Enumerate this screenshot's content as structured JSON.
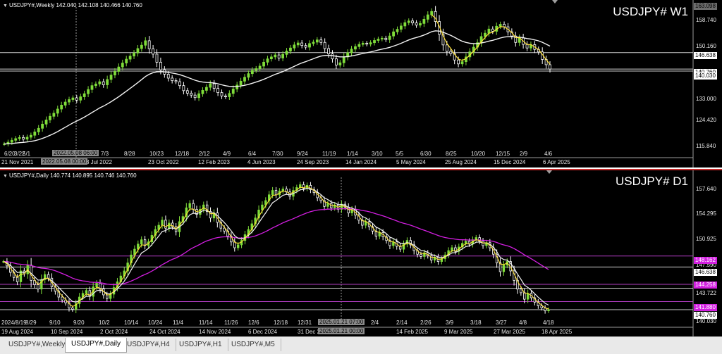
{
  "colors": {
    "background": "#000000",
    "bull_candle": "#7fdc3a",
    "bear_candle": "#ffffff",
    "ma_white": "#f2f2f2",
    "ma_yellow": "#ffe135",
    "ma_magenta": "#d21ee0",
    "level_line": "#cfcfcf",
    "tag_magenta": "#d21ee0",
    "divider": "#c62828"
  },
  "weekly": {
    "info": "USDJPY#,Weekly  142.040  142.108 140.466 140.760",
    "title": "USDJPY# W1",
    "price_ticks": [
      "158.740",
      "150.160",
      "141.580",
      "133.000",
      "124.420",
      "115.840"
    ],
    "price_tags": [
      {
        "text": "163.098",
        "style": "plain"
      },
      {
        "text": "146.638",
        "style": "white"
      },
      {
        "text": "140.760",
        "style": "white"
      },
      {
        "text": "140.030",
        "style": "white"
      }
    ],
    "ylim": [
      112,
      164
    ],
    "levels": [
      146.638,
      140.76,
      140.03
    ],
    "crosshair_tag": "2022.05.08 06:00",
    "crosshair_tag2": "2022.05.08 00:00",
    "top_dates": [
      "6/20",
      "3/22",
      "5/1",
      "7/3",
      "8/28",
      "10/23",
      "12/18",
      "2/12",
      "4/9",
      "6/4",
      "7/30",
      "9/24",
      "11/19",
      "1/14",
      "3/10",
      "5/5",
      "6/30",
      "8/25",
      "10/20",
      "12/15",
      "2/9",
      "4/6"
    ],
    "bottom_dates": [
      "21 Nov 2021",
      "3 Jul 2022",
      "23 Oct 2022",
      "12 Feb 2023",
      "4 Jun 2023",
      "24 Sep 2023",
      "14 Jan 2024",
      "5 May 2024",
      "25 Aug 2024",
      "15 Dec 2024",
      "6 Apr 2025"
    ]
  },
  "daily": {
    "info": "USDJPY#,Daily  140.774 140.895 140.746 140.760",
    "title": "USDJPY# D1",
    "price_ticks": [
      "157.640",
      "154.295",
      "150.925",
      "147.590",
      "143.722",
      "140.030"
    ],
    "price_tags": [
      {
        "text": "148.162",
        "style": "magenta"
      },
      {
        "text": "146.638",
        "style": "white"
      },
      {
        "text": "144.258",
        "style": "magenta"
      },
      {
        "text": "141.880",
        "style": "magenta"
      },
      {
        "text": "140.760",
        "style": "white"
      }
    ],
    "ylim": [
      139.4,
      159.2
    ],
    "levels_white": [
      146.638,
      143.722,
      140.76
    ],
    "levels_magenta": [
      148.162,
      144.258,
      141.88
    ],
    "crosshair_tag": "2025.01.21 07:00",
    "crosshair_tag2": "2025.01.21 00:00",
    "top_dates": [
      "2024/8/19",
      "8/29",
      "9/10",
      "9/20",
      "10/2",
      "10/14",
      "10/24",
      "11/4",
      "11/14",
      "11/26",
      "12/6",
      "12/18",
      "12/31",
      "1/9",
      "1/21",
      "2/4",
      "2/14",
      "2/26",
      "3/9",
      "3/18",
      "3/27",
      "4/8",
      "4/18"
    ],
    "bottom_dates": [
      "19 Aug 2024",
      "10 Sep 2024",
      "2 Oct 2024",
      "24 Oct 2024",
      "14 Nov 2024",
      "6 Dec 2024",
      "31 Dec 2024",
      "21 Jan 2025",
      "14 Feb 2025",
      "9 Mar 2025",
      "27 Mar 2025",
      "18 Apr 2025"
    ]
  },
  "tabs": [
    {
      "label": "USDJPY#,Weekly",
      "active": false
    },
    {
      "label": "USDJPY#,Daily",
      "active": true
    },
    {
      "label": "USDJPY#,H4",
      "active": false
    },
    {
      "label": "USDJPY#,H1",
      "active": false
    },
    {
      "label": "USDJPY#,M5",
      "active": false
    }
  ],
  "chart_data": [
    {
      "type": "candlestick",
      "title": "USDJPY# W1",
      "symbol": "USDJPY#",
      "timeframe": "Weekly",
      "ylim": [
        112,
        164
      ],
      "closes": [
        113.9,
        114.5,
        115.2,
        115.8,
        116.2,
        115.6,
        116.3,
        117.0,
        118.2,
        119.5,
        121.0,
        122.5,
        123.8,
        124.9,
        126.4,
        127.8,
        128.9,
        129.8,
        130.4,
        129.6,
        130.8,
        131.9,
        133.4,
        134.8,
        135.4,
        136.2,
        135.1,
        137.0,
        138.6,
        139.9,
        141.5,
        142.9,
        144.3,
        145.4,
        146.5,
        148.1,
        149.3,
        150.9,
        148.0,
        146.1,
        143.2,
        140.5,
        138.9,
        137.5,
        136.6,
        136.2,
        134.8,
        133.0,
        132.1,
        131.4,
        130.5,
        131.9,
        133.1,
        134.2,
        135.5,
        133.8,
        132.3,
        131.1,
        130.8,
        132.0,
        133.6,
        135.0,
        136.4,
        137.8,
        139.1,
        140.3,
        140.9,
        141.8,
        143.2,
        144.4,
        145.1,
        145.8,
        144.7,
        146.0,
        147.2,
        148.3,
        149.4,
        150.1,
        149.2,
        148.6,
        149.9,
        150.4,
        151.2,
        150.3,
        148.1,
        146.2,
        144.4,
        142.2,
        143.0,
        145.1,
        146.6,
        147.9,
        148.8,
        149.6,
        150.0,
        149.7,
        150.2,
        151.0,
        151.5,
        151.8,
        151.3,
        152.6,
        154.1,
        155.0,
        156.2,
        157.4,
        158.0,
        157.3,
        156.5,
        157.1,
        158.6,
        160.2,
        161.4,
        157.8,
        153.2,
        149.4,
        147.1,
        146.3,
        144.0,
        142.6,
        143.4,
        145.1,
        146.9,
        148.6,
        150.2,
        152.4,
        153.6,
        155.1,
        154.3,
        156.1,
        156.8,
        155.9,
        154.1,
        152.6,
        150.3,
        151.9,
        149.6,
        148.3,
        149.5,
        147.8,
        146.9,
        144.2,
        142.3,
        140.76
      ]
    },
    {
      "type": "candlestick",
      "title": "USDJPY# D1",
      "symbol": "USDJPY#",
      "timeframe": "Daily",
      "ylim": [
        139.4,
        159.2
      ],
      "closes": [
        147.4,
        146.8,
        145.9,
        145.2,
        144.6,
        146.1,
        145.7,
        146.9,
        144.8,
        144.2,
        143.6,
        144.9,
        145.6,
        145.1,
        143.9,
        143.3,
        142.5,
        142.1,
        141.7,
        141.0,
        140.8,
        141.6,
        142.5,
        143.0,
        143.4,
        142.6,
        143.9,
        144.4,
        143.6,
        142.8,
        142.3,
        142.9,
        143.8,
        144.6,
        145.4,
        146.1,
        147.2,
        148.3,
        149.1,
        149.8,
        150.4,
        149.6,
        150.1,
        151.0,
        151.8,
        152.4,
        153.1,
        152.0,
        152.7,
        152.2,
        151.5,
        152.9,
        153.6,
        154.8,
        155.4,
        154.6,
        153.9,
        154.6,
        155.2,
        154.3,
        153.4,
        154.1,
        152.8,
        152.0,
        151.6,
        150.9,
        150.1,
        149.3,
        149.7,
        150.3,
        151.1,
        151.8,
        152.6,
        153.4,
        154.5,
        155.2,
        155.8,
        156.6,
        157.2,
        156.6,
        157.1,
        157.4,
        157.0,
        156.4,
        157.2,
        157.6,
        158.0,
        157.5,
        157.9,
        157.3,
        156.9,
        156.2,
        155.8,
        155.0,
        155.4,
        154.8,
        155.2,
        154.6,
        155.3,
        154.9,
        154.1,
        154.6,
        153.8,
        153.1,
        152.4,
        152.9,
        152.2,
        151.6,
        150.9,
        151.4,
        150.8,
        150.3,
        149.6,
        150.1,
        149.5,
        149.1,
        149.8,
        150.3,
        149.7,
        148.9,
        148.4,
        148.1,
        148.6,
        148.2,
        147.6,
        148.0,
        147.4,
        147.8,
        148.3,
        148.9,
        149.3,
        148.8,
        149.4,
        149.9,
        150.2,
        149.8,
        150.4,
        150.7,
        150.2,
        149.6,
        150.0,
        149.3,
        148.4,
        147.2,
        146.0,
        146.9,
        147.4,
        146.1,
        144.8,
        143.6,
        143.1,
        142.2,
        143.0,
        142.4,
        141.8,
        141.3,
        141.0,
        140.6,
        140.76
      ]
    }
  ]
}
